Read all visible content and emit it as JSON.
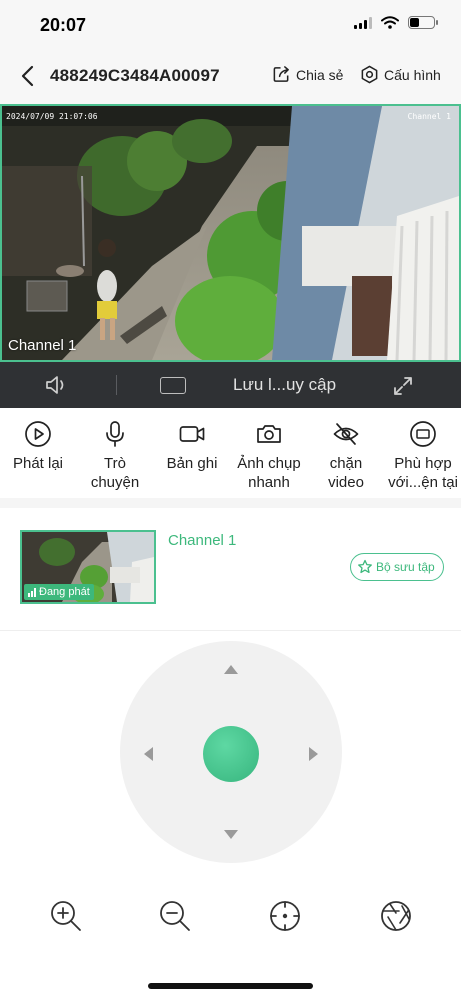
{
  "status_bar": {
    "time": "20:07"
  },
  "header": {
    "device_id": "488249C3484A00097",
    "share_label": "Chia sẻ",
    "config_label": "Cấu hình"
  },
  "video": {
    "timestamp": "2024/07/09 21:07:06",
    "osd_channel": "Channel 1",
    "channel_label": "Channel 1"
  },
  "control_bar": {
    "quality_label": "Lưu l...uy cập"
  },
  "tools": [
    {
      "label": "Phát lại",
      "icon": "play-circle-icon"
    },
    {
      "label": "Trò\nchuyện",
      "icon": "microphone-icon"
    },
    {
      "label": "Bản ghi",
      "icon": "video-camera-icon"
    },
    {
      "label": "Ảnh chụp\nnhanh",
      "icon": "camera-icon"
    },
    {
      "label": "chặn\nvideo",
      "icon": "eye-off-icon"
    },
    {
      "label": "Phù hợp\nvới...ện tại",
      "icon": "fit-screen-icon"
    }
  ],
  "channel": {
    "name": "Channel 1",
    "status_badge": "Đang phát",
    "favorite_label": "Bộ sưu tập"
  },
  "ptz": {
    "up": "arrow-up-icon",
    "down": "arrow-down-icon",
    "left": "arrow-left-icon",
    "right": "arrow-right-icon"
  },
  "bottom_tools": [
    "zoom-in-icon",
    "zoom-out-icon",
    "focus-icon",
    "aperture-icon"
  ],
  "colors": {
    "accent": "#3db87c",
    "control_bar": "#2f3134",
    "background": "#ffffff"
  }
}
